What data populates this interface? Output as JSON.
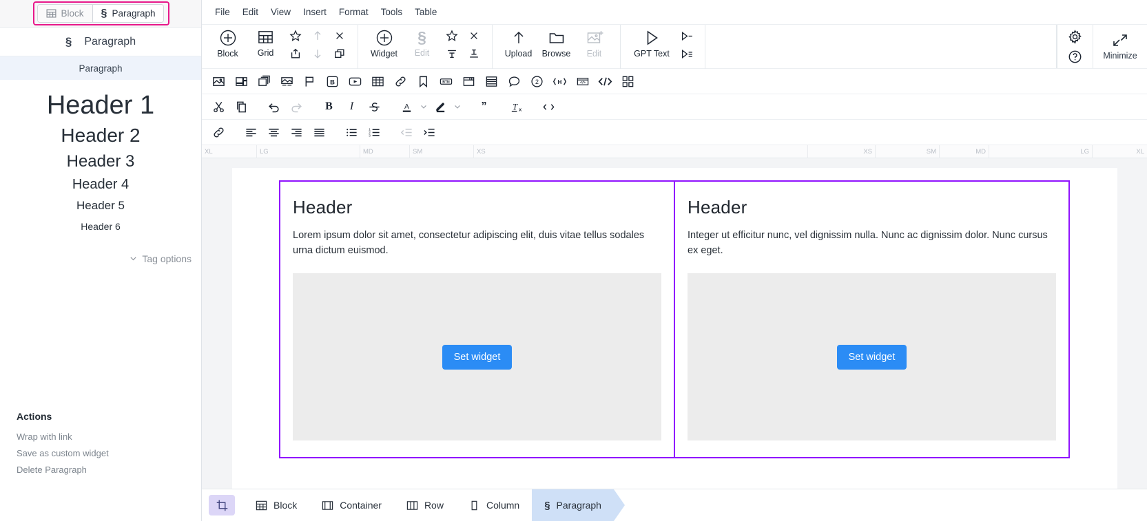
{
  "sidebar": {
    "tabs": [
      {
        "label": "Block",
        "icon": "grid-icon",
        "active": false
      },
      {
        "label": "Paragraph",
        "icon": "paragraph-icon",
        "active": true
      }
    ],
    "type_row": {
      "glyph": "§",
      "label": "Paragraph"
    },
    "selected_tag": "Paragraph",
    "headers_preview": [
      "Header 1",
      "Header 2",
      "Header 3",
      "Header 4",
      "Header 5",
      "Header 6"
    ],
    "tag_options_label": "Tag options",
    "actions": {
      "title": "Actions",
      "items": [
        "Wrap with link",
        "Save as custom widget",
        "Delete Paragraph"
      ]
    }
  },
  "menubar": {
    "items": [
      "File",
      "Edit",
      "View",
      "Insert",
      "Format",
      "Tools",
      "Table"
    ]
  },
  "ribbon": {
    "groups": [
      {
        "name": "block-group",
        "buttons": [
          {
            "label": "Block",
            "icon": "plus-circle-icon",
            "disabled": false
          },
          {
            "label": "Grid",
            "icon": "grid-icon",
            "disabled": false
          }
        ],
        "mini": [
          {
            "icon": "star-icon",
            "disabled": false
          },
          {
            "icon": "box-upload-icon",
            "disabled": false
          },
          {
            "icon": "arrow-up-icon",
            "disabled": true
          },
          {
            "icon": "arrow-down-icon",
            "disabled": true
          },
          {
            "icon": "close-icon",
            "disabled": false
          },
          {
            "icon": "duplicate-icon",
            "disabled": false
          }
        ]
      },
      {
        "name": "widget-group",
        "buttons": [
          {
            "label": "Widget",
            "icon": "plus-circle-icon",
            "disabled": false
          },
          {
            "label": "Edit",
            "icon": "paragraph-icon",
            "disabled": true
          }
        ],
        "mini": [
          {
            "icon": "star-icon",
            "disabled": false
          },
          {
            "icon": "align-top-icon",
            "disabled": false
          },
          {
            "icon": "close-icon",
            "disabled": false
          },
          {
            "icon": "align-bottom-icon",
            "disabled": false
          }
        ]
      },
      {
        "name": "media-group",
        "buttons": [
          {
            "label": "Upload",
            "icon": "arrow-up-icon",
            "disabled": false
          },
          {
            "label": "Browse",
            "icon": "folder-icon",
            "disabled": false
          },
          {
            "label": "Edit",
            "icon": "image-edit-icon",
            "disabled": true
          }
        ],
        "mini": []
      },
      {
        "name": "gpt-group",
        "buttons": [
          {
            "label": "GPT Text",
            "icon": "play-icon",
            "disabled": false
          }
        ],
        "mini": [
          {
            "icon": "play-line-icon",
            "disabled": false
          },
          {
            "icon": "play-lines-icon",
            "disabled": false
          }
        ]
      }
    ],
    "right": {
      "icons": [
        {
          "icon": "gear-icon"
        },
        {
          "icon": "help-circle-icon"
        }
      ],
      "minimize": {
        "label": "Minimize",
        "icon": "minimize-icon"
      }
    }
  },
  "insert_toolbar": {
    "buttons": [
      {
        "icon": "image-icon"
      },
      {
        "icon": "image-gallery-icon"
      },
      {
        "icon": "image-stack-icon"
      },
      {
        "icon": "image-caption-icon"
      },
      {
        "icon": "flag-icon"
      },
      {
        "icon": "bold-box-icon"
      },
      {
        "icon": "video-icon"
      },
      {
        "icon": "table-icon"
      },
      {
        "icon": "link-icon"
      },
      {
        "icon": "bookmark-icon"
      },
      {
        "icon": "btn-icon"
      },
      {
        "icon": "window-icon"
      },
      {
        "icon": "layout-rows-icon"
      },
      {
        "icon": "comment-icon"
      },
      {
        "icon": "circle-two-icon"
      },
      {
        "icon": "h-tag-icon"
      },
      {
        "icon": "embed-code-icon"
      },
      {
        "icon": "code-icon"
      },
      {
        "icon": "apps-grid-icon"
      }
    ]
  },
  "format_toolbar": {
    "buttons": [
      {
        "icon": "cut-icon",
        "disabled": false
      },
      {
        "icon": "copy-icon",
        "disabled": false
      },
      {
        "icon": "undo-icon",
        "disabled": false
      },
      {
        "icon": "redo-icon",
        "disabled": true
      },
      {
        "icon": "bold-icon",
        "disabled": false
      },
      {
        "icon": "italic-icon",
        "disabled": false
      },
      {
        "icon": "strikethrough-icon",
        "disabled": false
      },
      {
        "icon": "text-color-icon",
        "disabled": false
      },
      {
        "icon": "highlight-color-icon",
        "disabled": false
      },
      {
        "icon": "blockquote-icon",
        "disabled": false
      },
      {
        "icon": "clear-formatting-icon",
        "disabled": false
      },
      {
        "icon": "source-code-icon",
        "disabled": false
      }
    ]
  },
  "align_toolbar": {
    "buttons": [
      {
        "icon": "link-icon",
        "disabled": false
      },
      {
        "icon": "align-left-icon",
        "disabled": false
      },
      {
        "icon": "align-center-icon",
        "disabled": false
      },
      {
        "icon": "align-right-icon",
        "disabled": false
      },
      {
        "icon": "align-justify-icon",
        "disabled": false
      },
      {
        "icon": "bullet-list-icon",
        "disabled": false
      },
      {
        "icon": "numbered-list-icon",
        "disabled": false
      },
      {
        "icon": "outdent-icon",
        "disabled": true
      },
      {
        "icon": "indent-icon",
        "disabled": false
      }
    ]
  },
  "ruler": {
    "left_marks": [
      "XL",
      "LG",
      "MD",
      "SM",
      "XS"
    ],
    "right_marks": [
      "XS",
      "SM",
      "MD",
      "LG",
      "XL"
    ]
  },
  "canvas": {
    "columns": [
      {
        "heading": "Header",
        "paragraph": "Lorem ipsum dolor sit amet, consectetur adipiscing elit, duis vitae tellus sodales urna dictum euismod.",
        "selected": true,
        "widget_button": "Set widget"
      },
      {
        "heading": "Header",
        "paragraph": "Integer ut efficitur nunc, vel dignissim nulla. Nunc ac dignissim dolor. Nunc cursus ex eget.",
        "selected": false,
        "widget_button": "Set widget"
      }
    ]
  },
  "statusbar": {
    "grid_icon": "crop-grid-icon",
    "crumbs": [
      {
        "label": "Block",
        "icon": "grid-icon",
        "active": false
      },
      {
        "label": "Container",
        "icon": "container-icon",
        "active": false
      },
      {
        "label": "Row",
        "icon": "row-icon",
        "active": false
      },
      {
        "label": "Column",
        "icon": "column-icon",
        "active": false
      },
      {
        "label": "Paragraph",
        "icon": "paragraph-icon",
        "active": true
      }
    ]
  },
  "colors": {
    "accent_blue": "#2b8cf5",
    "selection_blue": "#3b6ff5",
    "outline_pink": "#e8188a",
    "block_purple": "#9013fe",
    "crumb_active": "#cfe0f7",
    "grid_btn_purple": "#dcd6f7"
  }
}
